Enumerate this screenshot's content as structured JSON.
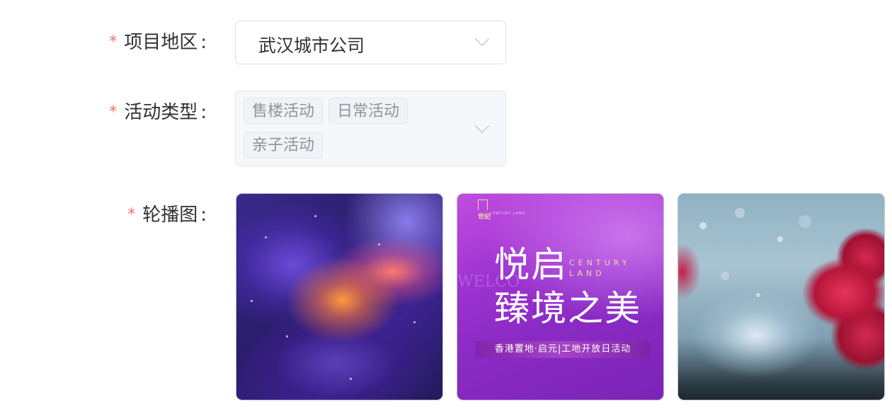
{
  "form": {
    "region": {
      "required_mark": "*",
      "label": "项目地区",
      "colon": ":",
      "value": "武汉城市公司"
    },
    "activity_type": {
      "required_mark": "*",
      "label": "活动类型",
      "colon": ":",
      "tags": [
        "售楼活动",
        "日常活动",
        "亲子活动"
      ]
    },
    "carousel": {
      "required_mark": "*",
      "label": "轮播图",
      "colon": ":",
      "images": [
        {
          "name": "abstract-purple-nebula"
        },
        {
          "name": "century-land-poster",
          "logo_text": "世纪",
          "logo_sub": "CENTURY LAND",
          "title_line1": "悦启",
          "title_line2": "臻境之美",
          "century_text": "CENTURY LAND",
          "watermark": "WELCO",
          "banner": "香港置地·启元|工地开放日活动"
        },
        {
          "name": "raspberries-water-splash"
        }
      ]
    }
  },
  "colors": {
    "required": "#f56c6c",
    "label": "#303133",
    "tag_text": "#909399",
    "border": "#dcdfe6"
  }
}
